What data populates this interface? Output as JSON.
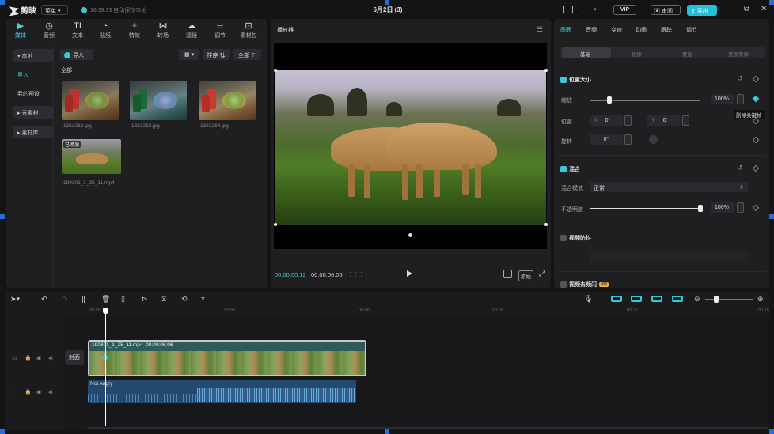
{
  "app": {
    "name": "剪映",
    "menu_label": "菜单",
    "saved_status": "16:39:33 自动保存本地",
    "project_title": "6月2日 (3)",
    "vip_label": "VIP",
    "review_label": "审阅",
    "export_label": "导出"
  },
  "toolbar": {
    "tabs": [
      {
        "label": "媒体",
        "icon": "media-icon"
      },
      {
        "label": "音频",
        "icon": "audio-icon"
      },
      {
        "label": "文本",
        "icon": "text-icon"
      },
      {
        "label": "贴纸",
        "icon": "sticker-icon"
      },
      {
        "label": "特效",
        "icon": "effects-icon"
      },
      {
        "label": "转场",
        "icon": "transition-icon"
      },
      {
        "label": "滤镜",
        "icon": "filter-icon"
      },
      {
        "label": "调节",
        "icon": "adjust-icon"
      },
      {
        "label": "素材包",
        "icon": "package-icon"
      }
    ],
    "active": 0
  },
  "sidebar": {
    "items": [
      {
        "label": "▾ 本地"
      },
      {
        "label": "导入"
      },
      {
        "label": "我的预设"
      },
      {
        "label": "▸ 云素材"
      },
      {
        "label": "▸ 素材库"
      }
    ]
  },
  "media": {
    "import_label": "导入",
    "sort_label": "排序",
    "filter_label": "全部",
    "section_label": "全部",
    "items": [
      {
        "name": "1353262.jpg"
      },
      {
        "name": "1353263.jpg"
      },
      {
        "name": "1353264.jpg"
      },
      {
        "name": "190301_1_25_11.mp4",
        "tag": "已添加"
      }
    ]
  },
  "player": {
    "title": "播放器",
    "current_time": "00:00:00:12",
    "duration": "00:00:06:06",
    "ratio_label": "原始"
  },
  "inspector": {
    "tabs": [
      "画面",
      "音频",
      "变速",
      "动画",
      "跟踪",
      "调节"
    ],
    "active_tab": 0,
    "subtabs": [
      "基础",
      "抠像",
      "蒙版",
      "美颜美体"
    ],
    "active_subtab": 0,
    "position_size": {
      "title": "位置大小",
      "scale_label": "缩放",
      "scale_value": "100%",
      "scale_fraction": 0.18,
      "position_label": "位置",
      "x_label": "X",
      "x_value": "0",
      "y_label": "Y",
      "y_value": "0",
      "rotate_label": "旋转",
      "rotate_value": "0°"
    },
    "tooltip": "删除关键帧",
    "blend": {
      "title": "混合",
      "mode_label": "混合模式",
      "mode_value": "正常",
      "opacity_label": "不透明度",
      "opacity_value": "100%",
      "opacity_fraction": 1.0
    },
    "stabilize_label": "视频防抖",
    "denoise_label": "视频去频闪",
    "vip_badge": "VIP"
  },
  "timeline": {
    "ruler_labels": [
      "00:00",
      "00:03",
      "00:06",
      "00:09",
      "00:12",
      "00:15"
    ],
    "cover_label": "封面",
    "video_clip": {
      "name": "190301_1_25_11.mp4",
      "duration": "00:00:06:06"
    },
    "audio_clip": {
      "name": "Not Angry"
    }
  },
  "colors": {
    "accent": "#22c0d6",
    "panel": "#1f1f22",
    "background": "#141416"
  }
}
